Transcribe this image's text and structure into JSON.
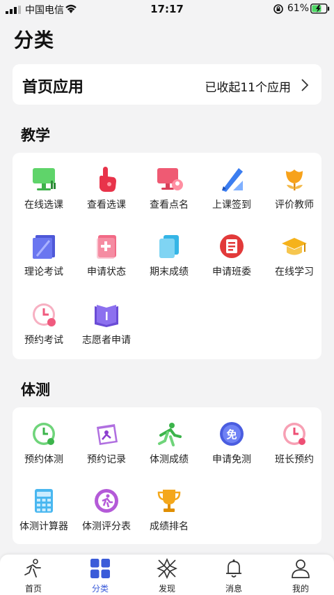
{
  "status_bar": {
    "carrier": "中国电信",
    "time": "17:17",
    "battery": "61%"
  },
  "page_title": "分类",
  "home_apps": {
    "label": "首页应用",
    "status": "已收起11个应用"
  },
  "sections": [
    {
      "title": "教学",
      "items": [
        {
          "label": "在线选课",
          "icon": "monitor-icon"
        },
        {
          "label": "查看选课",
          "icon": "hand-pointer-icon"
        },
        {
          "label": "查看点名",
          "icon": "screen-user-icon"
        },
        {
          "label": "上课签到",
          "icon": "pen-ruler-icon"
        },
        {
          "label": "评价教师",
          "icon": "flower-icon"
        },
        {
          "label": "理论考试",
          "icon": "paper-icon"
        },
        {
          "label": "申请状态",
          "icon": "doc-plus-icon"
        },
        {
          "label": "期末成绩",
          "icon": "files-icon"
        },
        {
          "label": "申请班委",
          "icon": "form-icon"
        },
        {
          "label": "在线学习",
          "icon": "grad-cap-icon"
        },
        {
          "label": "预约考试",
          "icon": "clock-icon"
        },
        {
          "label": "志愿者申请",
          "icon": "book-icon"
        }
      ]
    },
    {
      "title": "体测",
      "items": [
        {
          "label": "预约体测",
          "icon": "clock-run-icon"
        },
        {
          "label": "预约记录",
          "icon": "calendar-run-icon"
        },
        {
          "label": "体测成绩",
          "icon": "sprinter-icon"
        },
        {
          "label": "申请免测",
          "icon": "exempt-badge-icon"
        },
        {
          "label": "班长预约",
          "icon": "clock-person-icon"
        },
        {
          "label": "体测计算器",
          "icon": "calculator-icon"
        },
        {
          "label": "体测评分表",
          "icon": "runner-sheet-icon"
        },
        {
          "label": "成绩排名",
          "icon": "trophy-icon"
        }
      ]
    }
  ],
  "tabbar": [
    {
      "label": "首页",
      "icon": "runner-icon",
      "active": false
    },
    {
      "label": "分类",
      "icon": "grid-icon",
      "active": true
    },
    {
      "label": "发现",
      "icon": "compass-icon",
      "active": false
    },
    {
      "label": "消息",
      "icon": "bell-icon",
      "active": false
    },
    {
      "label": "我的",
      "icon": "user-icon",
      "active": false
    }
  ]
}
